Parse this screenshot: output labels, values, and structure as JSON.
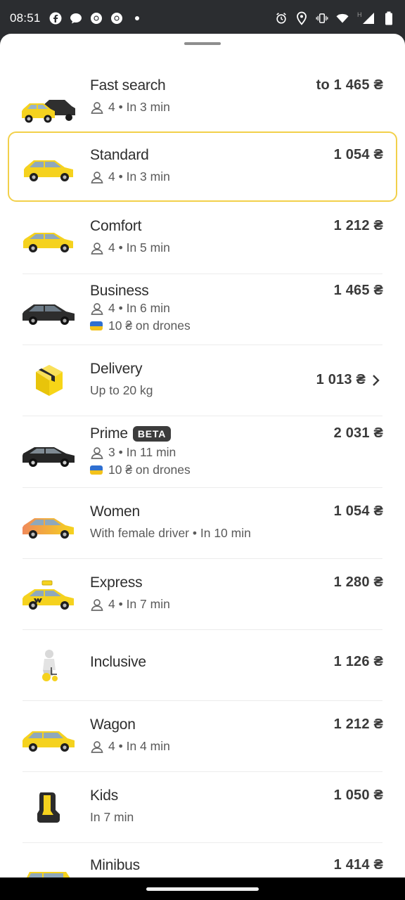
{
  "status_bar": {
    "time": "08:51",
    "left_icons": [
      "facebook-icon",
      "chat-bubble-icon",
      "chrome-icon",
      "chrome-icon",
      "notification-dot"
    ],
    "right_icons": [
      "alarm-icon",
      "location-icon",
      "vibrate-icon",
      "wifi-icon",
      "signal-icon",
      "battery-icon"
    ],
    "network_label": "H"
  },
  "colors": {
    "accent": "#f2d04a",
    "taxi_yellow": "#f5d21e",
    "text": "#2e2e2e",
    "subtext": "#5a5a5a"
  },
  "tariffs": [
    {
      "title": "Fast search",
      "capacity": "4",
      "eta": "In 3 min",
      "price": "to 1 465 ₴",
      "icon": "taxi-pair-icon"
    },
    {
      "title": "Standard",
      "capacity": "4",
      "eta": "In 3 min",
      "price": "1 054 ₴",
      "icon": "yellow-car-icon",
      "selected": true
    },
    {
      "title": "Comfort",
      "capacity": "4",
      "eta": "In 5 min",
      "price": "1 212 ₴",
      "icon": "yellow-car-icon"
    },
    {
      "title": "Business",
      "capacity": "4",
      "eta": "In 6 min",
      "donation": "10 ₴ on drones",
      "price": "1 465 ₴",
      "icon": "black-car-icon"
    },
    {
      "title": "Delivery",
      "subtitle": "Up to 20 kg",
      "price": "1 013 ₴",
      "icon": "parcel-box-icon"
    },
    {
      "title": "Prime",
      "badge": "BETA",
      "capacity": "3",
      "eta": "In 11 min",
      "donation": "10 ₴ on drones",
      "price": "2 031 ₴",
      "icon": "black-sedan-icon"
    },
    {
      "title": "Women",
      "subtitle": "With female driver • In 10 min",
      "price": "1 054 ₴",
      "icon": "gradient-car-icon"
    },
    {
      "title": "Express",
      "capacity": "4",
      "eta": "In 7 min",
      "price": "1 280 ₴",
      "icon": "taxi-car-icon"
    },
    {
      "title": "Inclusive",
      "price": "1 126 ₴",
      "icon": "wheelchair-icon"
    },
    {
      "title": "Wagon",
      "capacity": "4",
      "eta": "In 4 min",
      "price": "1 212 ₴",
      "icon": "yellow-wagon-icon"
    },
    {
      "title": "Kids",
      "subtitle": "In 7 min",
      "price": "1 050 ₴",
      "icon": "child-seat-icon"
    },
    {
      "title": "Minibus",
      "price": "1 414 ₴",
      "icon": "minibus-icon"
    }
  ]
}
